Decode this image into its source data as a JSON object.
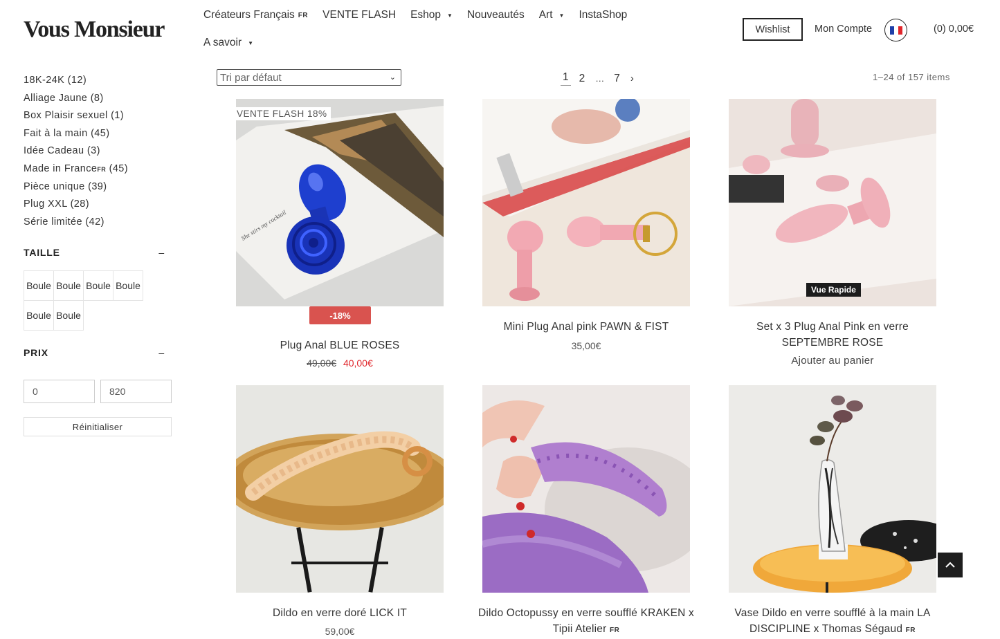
{
  "logo": "Vous Monsieur",
  "nav": {
    "row1": [
      {
        "label": "Créateurs Français",
        "flag": "FR"
      },
      {
        "label": "VENTE FLASH"
      },
      {
        "label": "Eshop",
        "caret": "▼"
      },
      {
        "label": "Nouveautés"
      },
      {
        "label": "Art",
        "caret": "▼"
      },
      {
        "label": "InstaShop"
      }
    ],
    "row2": [
      {
        "label": "A savoir",
        "caret": "▼"
      }
    ]
  },
  "header": {
    "wishlist": "Wishlist",
    "account": "Mon Compte",
    "cart": "(0)  0,00€",
    "flag_colors": [
      "#1f3fa8",
      "#ffffff",
      "#e0262b"
    ]
  },
  "filters": {
    "categories": [
      {
        "label": "18K-24K",
        "count": "(12)"
      },
      {
        "label": "Alliage Jaune",
        "count": "(8)"
      },
      {
        "label": "Box Plaisir sexuel",
        "count": "(1)"
      },
      {
        "label": "Fait à la main",
        "count": "(45)"
      },
      {
        "label": "Idée Cadeau",
        "count": "(3)"
      },
      {
        "label": "Made in France",
        "sup": "FR",
        "count": "(45)"
      },
      {
        "label": "Pièce unique",
        "count": "(39)"
      },
      {
        "label": "Plug XXL",
        "count": "(28)"
      },
      {
        "label": "Série limitée",
        "count": "(42)"
      }
    ],
    "taille_title": "TAILLE",
    "collapse_symbol": "–",
    "sizes": [
      "Boule",
      "Boule",
      "Boule",
      "Boule",
      "Boule",
      "Boule"
    ],
    "prix_title": "PRIX",
    "price_min": "0",
    "price_max": "820",
    "reset": "Réinitialiser"
  },
  "toolbar": {
    "sort_label": "Tri par défaut",
    "sort_chevron": "⌄",
    "pages": [
      "1",
      "2",
      "…",
      "7"
    ],
    "next": "›",
    "count": "1–24 of 157 items"
  },
  "products": [
    {
      "title": "Plug Anal BLUE ROSES",
      "badge": "VENTE FLASH 18%",
      "sale": "-18%",
      "old_price": "49,00€",
      "price": "40,00€"
    },
    {
      "title": "Mini Plug Anal pink PAWN & FIST",
      "price": "35,00€"
    },
    {
      "title": "Set x 3 Plug Anal Pink en verre SEPTEMBRE ROSE",
      "quick_view": "Vue Rapide",
      "cta": "Ajouter au panier"
    },
    {
      "title": "Dildo en verre doré LICK IT",
      "price": "59,00€"
    },
    {
      "title": "Dildo Octopussy en verre soufflé KRAKEN x Tipii Atelier",
      "flag": "FR"
    },
    {
      "title": "Vase Dildo en verre soufflé à la main LA DISCIPLINE x Thomas Ségaud",
      "flag": "FR"
    }
  ],
  "colors": {
    "sale_red": "#d9534f",
    "price_red": "#e0262b",
    "dark": "#1e1e1e"
  },
  "icons": {
    "to_top": "chevron-up-icon"
  }
}
